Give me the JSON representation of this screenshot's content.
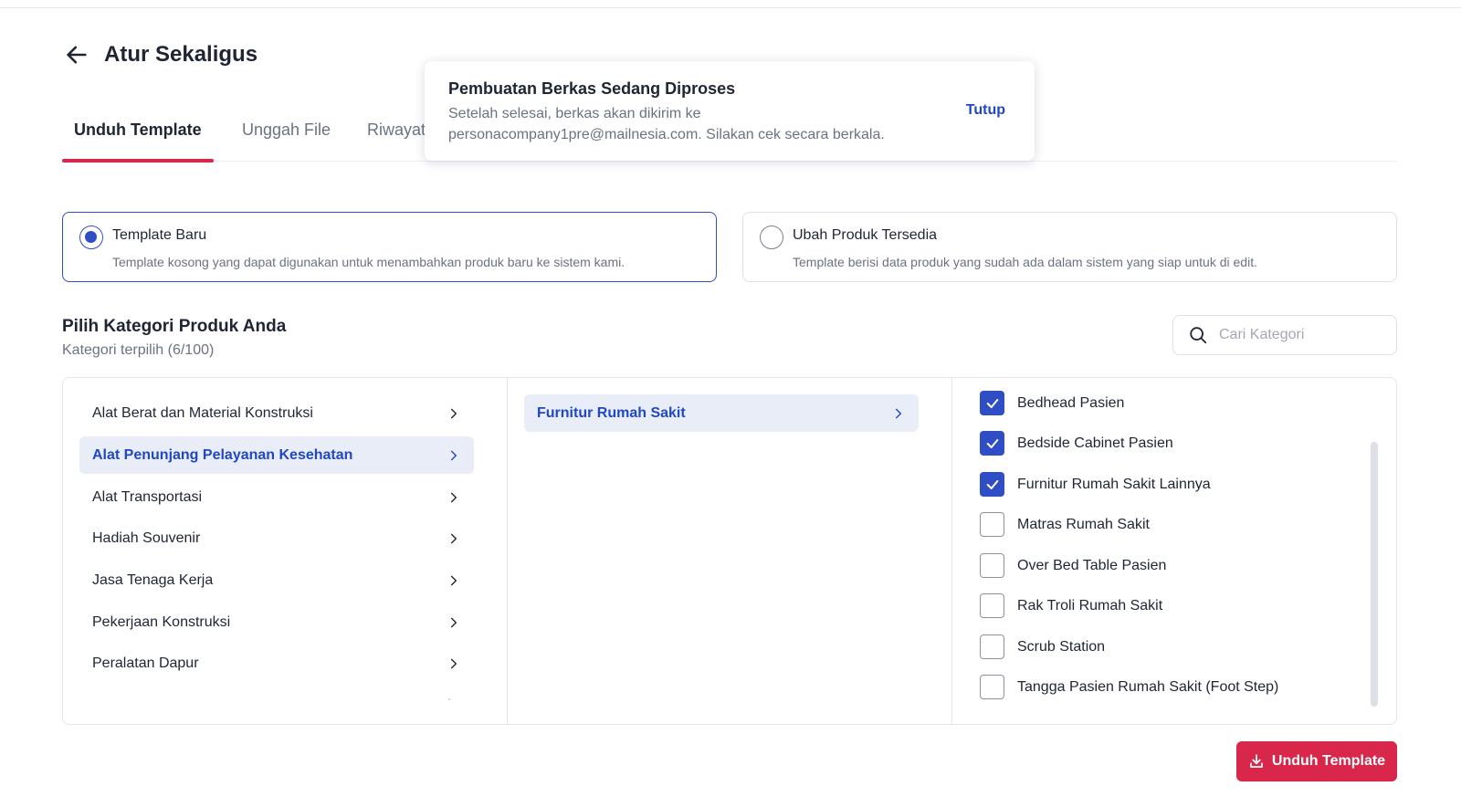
{
  "header": {
    "title": "Atur Sekaligus",
    "back_icon": "arrow-left-icon"
  },
  "tabs": [
    {
      "label": "Unduh Template",
      "active": true
    },
    {
      "label": "Unggah File",
      "active": false
    },
    {
      "label": "Riwayat",
      "active": false
    }
  ],
  "toast": {
    "title": "Pembuatan Berkas Sedang Diproses",
    "message": "Setelah selesai, berkas akan dikirim ke personacompany1pre@mailnesia.com. Silakan cek secara berkala.",
    "close_label": "Tutup"
  },
  "template_options": [
    {
      "title": "Template Baru",
      "description": "Template kosong yang dapat digunakan untuk menambahkan produk baru ke sistem kami.",
      "selected": true
    },
    {
      "title": "Ubah Produk Tersedia",
      "description": "Template berisi data produk yang sudah ada dalam sistem yang siap untuk di edit.",
      "selected": false
    }
  ],
  "category_section": {
    "title": "Pilih Kategori Produk Anda",
    "subtitle": "Kategori terpilih (6/100)"
  },
  "search": {
    "placeholder": "Cari Kategori",
    "icon": "search-icon"
  },
  "categories_level1": [
    {
      "label": "Alat Berat dan Material Konstruksi",
      "active": false
    },
    {
      "label": "Alat Penunjang Pelayanan Kesehatan",
      "active": true
    },
    {
      "label": "Alat Transportasi",
      "active": false
    },
    {
      "label": "Hadiah Souvenir",
      "active": false
    },
    {
      "label": "Jasa Tenaga Kerja",
      "active": false
    },
    {
      "label": "Pekerjaan Konstruksi",
      "active": false
    },
    {
      "label": "Peralatan Dapur",
      "active": false
    }
  ],
  "categories_level2": [
    {
      "label": "Furnitur Rumah Sakit",
      "active": true
    }
  ],
  "categories_level3": [
    {
      "label": "Bedhead Pasien",
      "checked": true
    },
    {
      "label": "Bedside Cabinet Pasien",
      "checked": true
    },
    {
      "label": "Furnitur Rumah Sakit Lainnya",
      "checked": true
    },
    {
      "label": "Matras Rumah Sakit",
      "checked": false
    },
    {
      "label": "Over Bed Table Pasien",
      "checked": false
    },
    {
      "label": "Rak Troli Rumah Sakit",
      "checked": false
    },
    {
      "label": "Scrub Station",
      "checked": false
    },
    {
      "label": "Tangga Pasien Rumah Sakit (Foot Step)",
      "checked": false
    }
  ],
  "download_button": {
    "label": "Unduh Template",
    "icon": "download-icon"
  },
  "colors": {
    "accent_red": "#d8274a",
    "primary_blue": "#2f4ec6",
    "link_blue": "#1f47c6"
  }
}
